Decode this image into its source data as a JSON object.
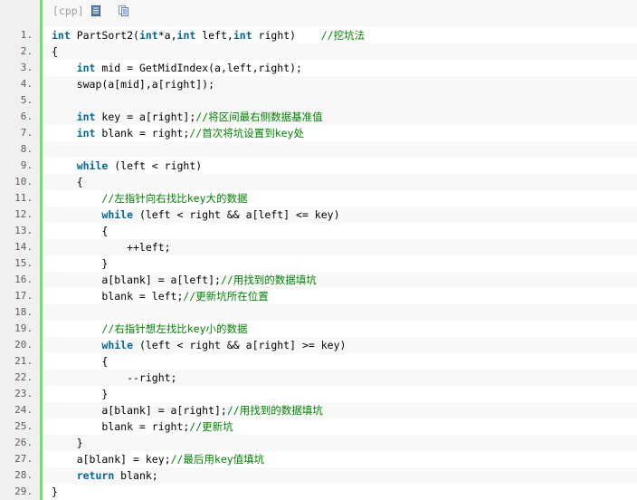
{
  "toolbar": {
    "language_label": "[cpp]",
    "icons": [
      "view-plain-icon",
      "copy-icon"
    ]
  },
  "code_lines": [
    {
      "num": "1.",
      "parts": [
        {
          "t": "int",
          "k": "kw"
        },
        {
          "t": " PartSort2("
        },
        {
          "t": "int",
          "k": "kw"
        },
        {
          "t": "*a,"
        },
        {
          "t": "int",
          "k": "kw"
        },
        {
          "t": " left,"
        },
        {
          "t": "int",
          "k": "kw"
        },
        {
          "t": " right)    "
        },
        {
          "t": "//挖坑法",
          "k": "cm"
        }
      ]
    },
    {
      "num": "2.",
      "parts": [
        {
          "t": "{"
        }
      ]
    },
    {
      "num": "3.",
      "parts": [
        {
          "t": "    "
        },
        {
          "t": "int",
          "k": "kw"
        },
        {
          "t": " mid = GetMidIndex(a,left,right);"
        }
      ]
    },
    {
      "num": "4.",
      "parts": [
        {
          "t": "    swap(a[mid],a[right]);"
        }
      ]
    },
    {
      "num": "5.",
      "parts": []
    },
    {
      "num": "6.",
      "parts": [
        {
          "t": "    "
        },
        {
          "t": "int",
          "k": "kw"
        },
        {
          "t": " key = a[right];"
        },
        {
          "t": "//将区间最右侧数据基准值",
          "k": "cm"
        }
      ]
    },
    {
      "num": "7.",
      "parts": [
        {
          "t": "    "
        },
        {
          "t": "int",
          "k": "kw"
        },
        {
          "t": " blank = right;"
        },
        {
          "t": "//首次将坑设置到key处",
          "k": "cm"
        }
      ]
    },
    {
      "num": "8.",
      "parts": []
    },
    {
      "num": "9.",
      "parts": [
        {
          "t": "    "
        },
        {
          "t": "while",
          "k": "kw"
        },
        {
          "t": " (left < right)"
        }
      ]
    },
    {
      "num": "10.",
      "parts": [
        {
          "t": "    {"
        }
      ]
    },
    {
      "num": "11.",
      "parts": [
        {
          "t": "        "
        },
        {
          "t": "//左指针向右找比key大的数据",
          "k": "cm"
        }
      ]
    },
    {
      "num": "12.",
      "parts": [
        {
          "t": "        "
        },
        {
          "t": "while",
          "k": "kw"
        },
        {
          "t": " (left < right && a[left] <= key)"
        }
      ]
    },
    {
      "num": "13.",
      "parts": [
        {
          "t": "        {"
        }
      ]
    },
    {
      "num": "14.",
      "parts": [
        {
          "t": "            ++left;"
        }
      ]
    },
    {
      "num": "15.",
      "parts": [
        {
          "t": "        }"
        }
      ]
    },
    {
      "num": "16.",
      "parts": [
        {
          "t": "        a[blank] = a[left];"
        },
        {
          "t": "//用找到的数据填坑",
          "k": "cm"
        }
      ]
    },
    {
      "num": "17.",
      "parts": [
        {
          "t": "        blank = left;"
        },
        {
          "t": "//更新坑所在位置",
          "k": "cm"
        }
      ]
    },
    {
      "num": "18.",
      "parts": []
    },
    {
      "num": "19.",
      "parts": [
        {
          "t": "        "
        },
        {
          "t": "//右指针想左找比key小的数据",
          "k": "cm"
        }
      ]
    },
    {
      "num": "20.",
      "parts": [
        {
          "t": "        "
        },
        {
          "t": "while",
          "k": "kw"
        },
        {
          "t": " (left < right && a[right] >= key)"
        }
      ]
    },
    {
      "num": "21.",
      "parts": [
        {
          "t": "        {"
        }
      ]
    },
    {
      "num": "22.",
      "parts": [
        {
          "t": "            --right;"
        }
      ]
    },
    {
      "num": "23.",
      "parts": [
        {
          "t": "        }"
        }
      ]
    },
    {
      "num": "24.",
      "parts": [
        {
          "t": "        a[blank] = a[right];"
        },
        {
          "t": "//用找到的数据填坑",
          "k": "cm"
        }
      ]
    },
    {
      "num": "25.",
      "parts": [
        {
          "t": "        blank = right;"
        },
        {
          "t": "//更新坑",
          "k": "cm"
        }
      ]
    },
    {
      "num": "26.",
      "parts": [
        {
          "t": "    }"
        }
      ]
    },
    {
      "num": "27.",
      "parts": [
        {
          "t": "    a[blank] = key;"
        },
        {
          "t": "//最后用key值填坑",
          "k": "cm"
        }
      ]
    },
    {
      "num": "28.",
      "parts": [
        {
          "t": "    "
        },
        {
          "t": "return",
          "k": "kw"
        },
        {
          "t": " blank;"
        }
      ]
    },
    {
      "num": "29.",
      "parts": [
        {
          "t": "}"
        }
      ]
    }
  ],
  "colors": {
    "keyword": "#006699",
    "comment": "#008200",
    "gutter_bar": "#6ce26c",
    "line_number": "#5c5c5c"
  }
}
